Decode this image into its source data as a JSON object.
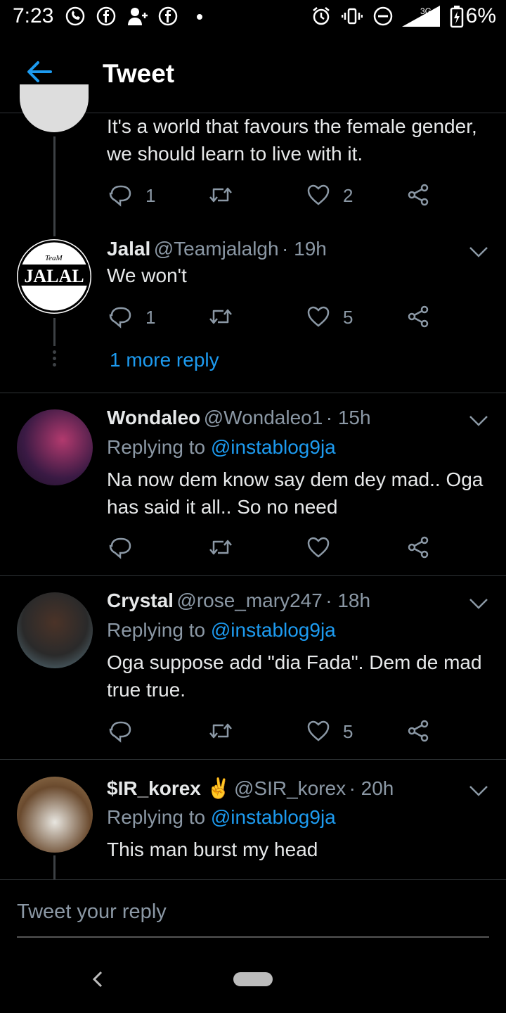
{
  "status_bar": {
    "time": "7:23",
    "battery": "6%",
    "network": "3G"
  },
  "header": {
    "title": "Tweet"
  },
  "tweets": [
    {
      "text": "It's a world that favours the female gender, we should learn to live with it.",
      "replies": "1",
      "retweets": "",
      "likes": "2"
    },
    {
      "name": "Jalal",
      "handle": "@Teamjalalgh",
      "time": "· 19h",
      "text": "We won't",
      "replies": "1",
      "retweets": "",
      "likes": "5"
    },
    {
      "name": "Wondaleo",
      "handle": "@Wondaleo1",
      "time": "· 15h",
      "replying_prefix": "Replying to ",
      "replying_to": "@instablog9ja",
      "text": "Na now dem know say dem dey mad.. Oga has said it all.. So no need",
      "replies": "",
      "retweets": "",
      "likes": ""
    },
    {
      "name": "Crystal",
      "handle": "@rose_mary247",
      "time": "· 18h",
      "replying_prefix": "Replying to ",
      "replying_to": "@instablog9ja",
      "text": "Oga suppose add \"dia Fada\". Dem de mad true true.",
      "replies": "",
      "retweets": "",
      "likes": "5"
    },
    {
      "name": "$IR_korex ✌️",
      "handle": "@SIR_korex",
      "time": "· 20h",
      "replying_prefix": "Replying to ",
      "replying_to": "@instablog9ja",
      "text": "This man burst my head"
    }
  ],
  "more_reply": "1 more reply",
  "avatar_jalal_text": {
    "top": "TeaM",
    "main": "JALAL"
  },
  "reply_box": {
    "placeholder": "Tweet your reply"
  },
  "colors": {
    "accent": "#1d9bf0",
    "secondary_text": "#8b98a5",
    "background": "#000000"
  }
}
